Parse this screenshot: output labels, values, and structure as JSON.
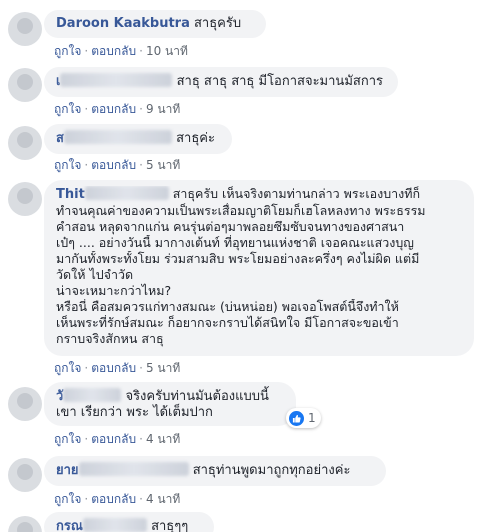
{
  "comments": [
    {
      "author": "Daroon Kaakbutra",
      "text": "สาธุครับ",
      "like": "ถูกใจ",
      "reply": "ตอบกลับ",
      "time": "10 นาที"
    },
    {
      "author": "เ",
      "text": "สาธุ สาธุ สาธุ มีโอกาสจะมานมัสการ",
      "like": "ถูกใจ",
      "reply": "ตอบกลับ",
      "time": "9 นาที"
    },
    {
      "author": "ส",
      "text": "สาธุค่ะ",
      "like": "ถูกใจ",
      "reply": "ตอบกลับ",
      "time": "5 นาที"
    },
    {
      "author": "Thit",
      "lines": [
        "สาธุครับ เห็นจริงตามท่านกล่าว พระเองบางทีก็",
        "ทำจนคุณค่าของความเป็นพระเสื่อมญาติโยมก็เฮโลหลงทาง พระธรรม",
        "คำสอน หลุดจากแก่น คนรุ่นต่อๆมาพลอยซึมซับจนทางของศาสนา",
        "เป๋ๆ .... อย่างวันนี้ มากางเต้นท์ ที่อุทยานแห่งชาติ เจอคณะแสวงบุญ",
        "มากันทั้งพระทั้งโยม ร่วมสามสิบ พระโยมอย่างละครึ่งๆ คงไม่ผิด แต่มี",
        "วัดให้ ไปจำวัด",
        "น่าจะเหมาะกว่าไหม?",
        "หรือนี่ คือสมควรแก่ทางสมณะ (บ่นหน่อย) พอเจอโพสต์นี้จึงทำให้",
        "เห็นพระที่รักษ์สมณะ ก็อยากจะกราบได้สนิทใจ มีโอกาสจะขอเข้า",
        "กราบจริงสักหน สาธุ"
      ],
      "like": "ถูกใจ",
      "reply": "ตอบกลับ",
      "time": "5 นาที"
    },
    {
      "author": "วั",
      "lines": [
        "จริงครับท่านมันต้องแบบนี้",
        "เขา เรียกว่า พระ ได้เต็มปาก"
      ],
      "reaction_count": "1",
      "like": "ถูกใจ",
      "reply": "ตอบกลับ",
      "time": "4 นาที"
    },
    {
      "author": "ยาย",
      "text": "สาธุท่านพูดมาถูกทุกอย่างค่ะ",
      "like": "ถูกใจ",
      "reply": "ตอบกลับ",
      "time": "4 นาที"
    },
    {
      "author": "กรณ",
      "text": "สาธุๆๆ"
    }
  ],
  "icons": {
    "reaction": "like-thumb-icon"
  },
  "colors": {
    "link": "#385898",
    "bubble": "#f2f3f5",
    "meta": "#606770",
    "like_blue": "#1877f2"
  }
}
